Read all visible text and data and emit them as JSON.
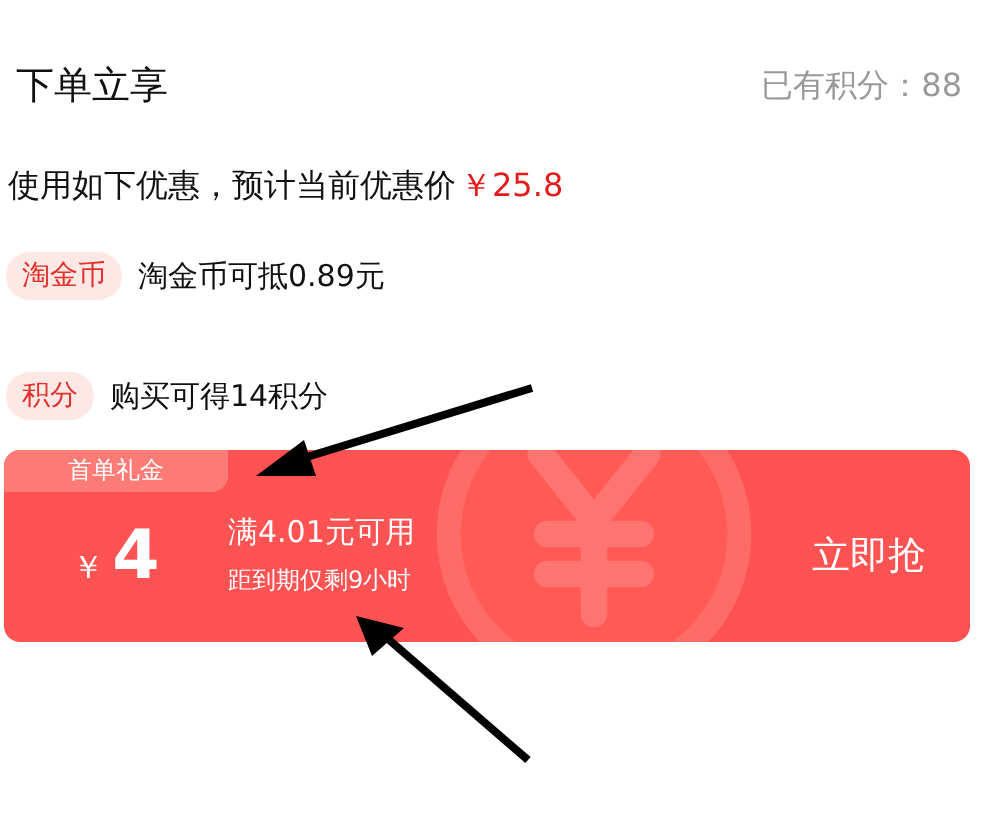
{
  "header": {
    "title": "下单立享",
    "points": "已有积分：88"
  },
  "summary": {
    "text": "使用如下优惠，预计当前优惠价",
    "price": "￥25.8"
  },
  "benefits": [
    {
      "tag": "淘金币",
      "text": "淘金币可抵0.89元"
    },
    {
      "tag": "积分",
      "text": "购买可得14积分"
    }
  ],
  "coupon": {
    "tab": "首单礼金",
    "currency": "￥",
    "amount": "4",
    "condition": "满4.01元可用",
    "expiry": "距到期仅剩9小时",
    "button": "立即抢"
  }
}
